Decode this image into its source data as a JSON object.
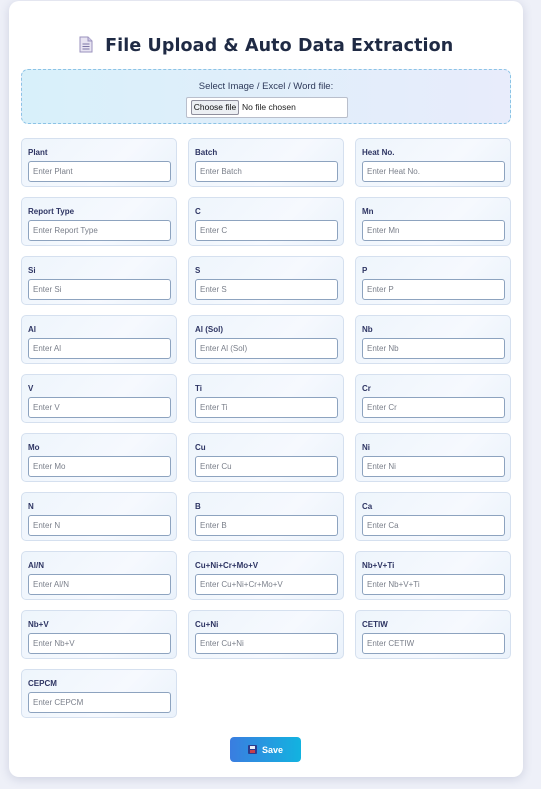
{
  "header": {
    "icon": "document-icon",
    "title": "File Upload & Auto Data Extraction"
  },
  "upload": {
    "label": "Select Image / Excel / Word file:",
    "button_label": "Choose file",
    "status": "No file chosen"
  },
  "fields": [
    {
      "label": "Plant",
      "placeholder": "Enter Plant",
      "value": ""
    },
    {
      "label": "Batch",
      "placeholder": "Enter Batch",
      "value": ""
    },
    {
      "label": "Heat No.",
      "placeholder": "Enter Heat No.",
      "value": ""
    },
    {
      "label": "Report Type",
      "placeholder": "Enter Report Type",
      "value": ""
    },
    {
      "label": "C",
      "placeholder": "Enter C",
      "value": ""
    },
    {
      "label": "Mn",
      "placeholder": "Enter Mn",
      "value": ""
    },
    {
      "label": "Si",
      "placeholder": "Enter Si",
      "value": ""
    },
    {
      "label": "S",
      "placeholder": "Enter S",
      "value": ""
    },
    {
      "label": "P",
      "placeholder": "Enter P",
      "value": ""
    },
    {
      "label": "Al",
      "placeholder": "Enter Al",
      "value": ""
    },
    {
      "label": "Al (Sol)",
      "placeholder": "Enter Al (Sol)",
      "value": ""
    },
    {
      "label": "Nb",
      "placeholder": "Enter Nb",
      "value": ""
    },
    {
      "label": "V",
      "placeholder": "Enter V",
      "value": ""
    },
    {
      "label": "Ti",
      "placeholder": "Enter Ti",
      "value": ""
    },
    {
      "label": "Cr",
      "placeholder": "Enter Cr",
      "value": ""
    },
    {
      "label": "Mo",
      "placeholder": "Enter Mo",
      "value": ""
    },
    {
      "label": "Cu",
      "placeholder": "Enter Cu",
      "value": ""
    },
    {
      "label": "Ni",
      "placeholder": "Enter Ni",
      "value": ""
    },
    {
      "label": "N",
      "placeholder": "Enter N",
      "value": ""
    },
    {
      "label": "B",
      "placeholder": "Enter B",
      "value": ""
    },
    {
      "label": "Ca",
      "placeholder": "Enter Ca",
      "value": ""
    },
    {
      "label": "Al/N",
      "placeholder": "Enter Al/N",
      "value": ""
    },
    {
      "label": "Cu+Ni+Cr+Mo+V",
      "placeholder": "Enter Cu+Ni+Cr+Mo+V",
      "value": ""
    },
    {
      "label": "Nb+V+Ti",
      "placeholder": "Enter Nb+V+Ti",
      "value": ""
    },
    {
      "label": "Nb+V",
      "placeholder": "Enter Nb+V",
      "value": ""
    },
    {
      "label": "Cu+Ni",
      "placeholder": "Enter Cu+Ni",
      "value": ""
    },
    {
      "label": "CETIW",
      "placeholder": "Enter CETIW",
      "value": ""
    },
    {
      "label": "CEPCM",
      "placeholder": "Enter CEPCM",
      "value": ""
    }
  ],
  "save": {
    "icon": "floppy-disk-icon",
    "label": "Save"
  },
  "colors": {
    "accent_start": "#3a7de0",
    "accent_end": "#12b3e0",
    "label_text": "#2e3563",
    "title_text": "#1f2a44"
  }
}
